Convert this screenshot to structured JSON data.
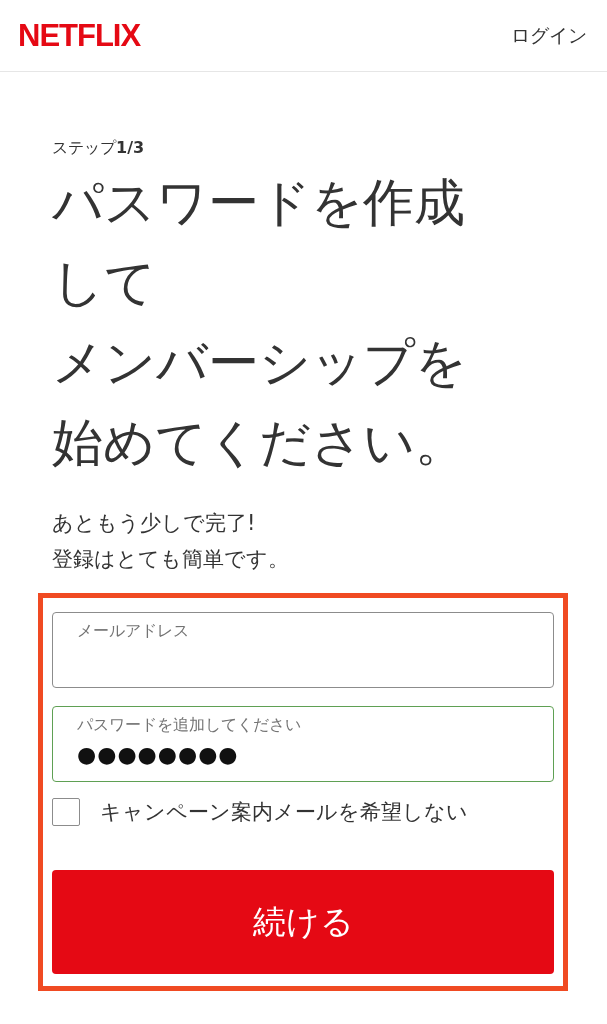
{
  "header": {
    "logo": "NETFLIX",
    "login_link": "ログイン"
  },
  "step": {
    "prefix": "ステップ",
    "count": "1/3"
  },
  "title_lines": [
    "パスワードを作成",
    "して",
    "メンバーシップを",
    "始めてください。"
  ],
  "subtitle_lines": [
    "あともう少しで完了!",
    "登録はとても簡単です。"
  ],
  "form": {
    "highlighted": true,
    "fields": [
      {
        "label": "メールアドレス",
        "focused": false
      },
      {
        "label": "パスワードを追加してください",
        "value": "●●●●●●●●",
        "focused": true
      }
    ],
    "checkbox": {
      "label": "キャンペーン案内メールを希望しない",
      "checked": false
    },
    "button": "続ける"
  }
}
